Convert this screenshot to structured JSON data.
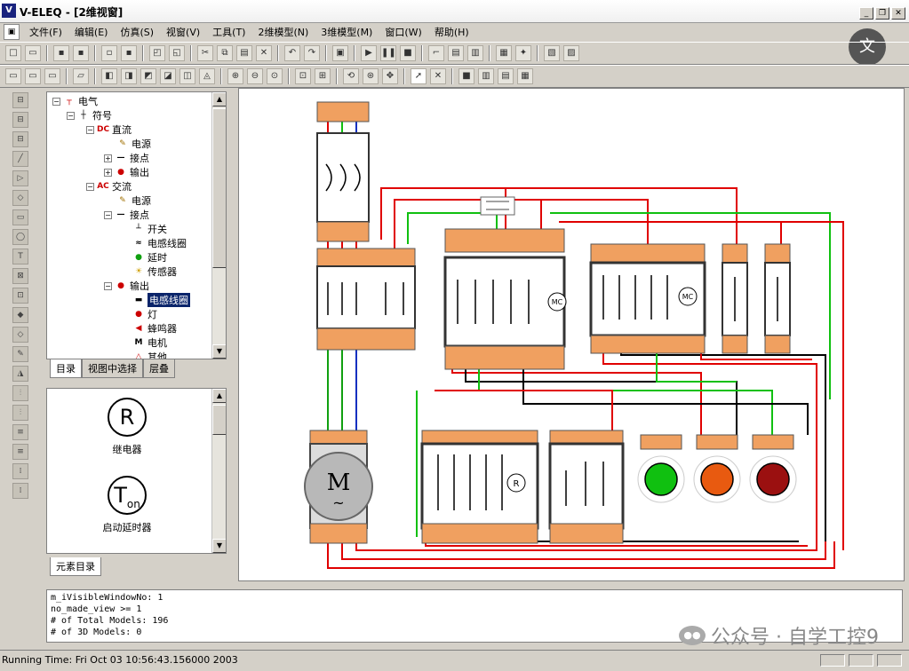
{
  "window": {
    "icon": "V",
    "title": "V-ELEQ - [2维视窗]",
    "buttons": {
      "minimize": "_",
      "restore": "❐",
      "close": "✕"
    }
  },
  "menu": {
    "doc_icon": "▣",
    "items": [
      "文件(F)",
      "编辑(E)",
      "仿真(S)",
      "视窗(V)",
      "工具(T)",
      "2维模型(N)",
      "3维模型(M)",
      "窗口(W)",
      "帮助(H)"
    ]
  },
  "tree": {
    "items": [
      {
        "label": "电气",
        "icon": "┬"
      },
      {
        "label": "符号",
        "icon": "┼"
      },
      {
        "label": "直流",
        "icon": "DC"
      },
      {
        "label": "电源",
        "icon": "✎"
      },
      {
        "label": "接点",
        "icon": "—"
      },
      {
        "label": "输出",
        "icon": "●"
      },
      {
        "label": "交流",
        "icon": "AC"
      },
      {
        "label": "电源",
        "icon": "✎"
      },
      {
        "label": "接点",
        "icon": "—"
      },
      {
        "label": "开关",
        "icon": "┴"
      },
      {
        "label": "电感线圈",
        "icon": "≈"
      },
      {
        "label": "延时",
        "icon": "●"
      },
      {
        "label": "传感器",
        "icon": "☀"
      },
      {
        "label": "输出",
        "icon": "●"
      },
      {
        "label": "电感线圈",
        "icon": "▬"
      },
      {
        "label": "灯",
        "icon": "●"
      },
      {
        "label": "蜂鸣器",
        "icon": "◀"
      },
      {
        "label": "电机",
        "icon": "M"
      },
      {
        "label": "其他",
        "icon": "△"
      }
    ]
  },
  "tabs": [
    "目录",
    "视图中选择",
    "层叠"
  ],
  "elements": [
    {
      "symbol": "R",
      "label": "继电器"
    },
    {
      "symbol": "T",
      "sub": "on",
      "label": "启动延时器"
    }
  ],
  "elem_tab": "元素目录",
  "canvas": {
    "motor_symbol": "M",
    "motor_wave": "~",
    "coil_mc": "MC",
    "coil_r": "R",
    "lamp_colors": [
      "#10c010",
      "#e85a10",
      "#9b1010"
    ]
  },
  "log_lines": [
    "m_iVisibleWindowNo: 1",
    "no_made_view >= 1",
    "# of Total Models: 196",
    "# of 3D Models: 0"
  ],
  "watermark": "公众号 · 自学工控9",
  "status_text": "Running Time: Fri Oct 03 10:56:43.156000 2003",
  "translate_icon": "文"
}
